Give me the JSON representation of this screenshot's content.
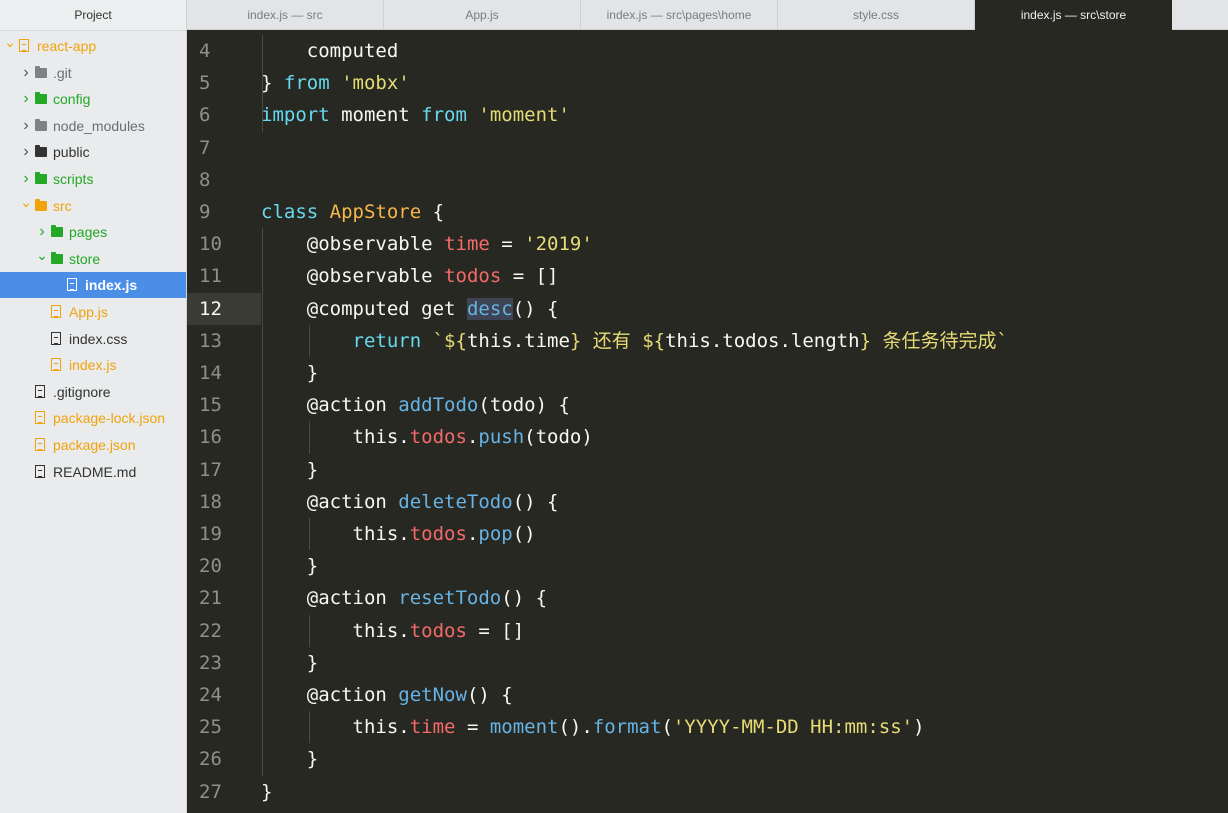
{
  "sidebar": {
    "title": "Project",
    "items": [
      {
        "label": "react-app",
        "icon": "project-icon",
        "arrow": "v",
        "depth": 0,
        "color": "#f0a30a",
        "type": "project"
      },
      {
        "label": ".git",
        "icon": "folder-icon",
        "arrow": ">",
        "depth": 1,
        "color": "#7f8285",
        "type": "folder"
      },
      {
        "label": "config",
        "icon": "folder-icon",
        "arrow": ">",
        "depth": 1,
        "color": "#23a827",
        "type": "folder"
      },
      {
        "label": "node_modules",
        "icon": "folder-icon",
        "arrow": ">",
        "depth": 1,
        "color": "#7f8285",
        "type": "folder"
      },
      {
        "label": "public",
        "icon": "folder-icon",
        "arrow": ">",
        "depth": 1,
        "color": "#333333",
        "type": "folder"
      },
      {
        "label": "scripts",
        "icon": "folder-icon",
        "arrow": ">",
        "depth": 1,
        "color": "#23a827",
        "type": "folder"
      },
      {
        "label": "src",
        "icon": "folder-icon",
        "arrow": "v",
        "depth": 1,
        "color": "#f0a30a",
        "type": "folder"
      },
      {
        "label": "pages",
        "icon": "folder-icon",
        "arrow": ">",
        "depth": 2,
        "color": "#23a827",
        "type": "folder"
      },
      {
        "label": "store",
        "icon": "folder-icon",
        "arrow": "v",
        "depth": 2,
        "color": "#23a827",
        "type": "folder"
      },
      {
        "label": "index.js",
        "icon": "file-icon",
        "arrow": "",
        "depth": 3,
        "color": "#ffffff",
        "type": "file",
        "selected": true
      },
      {
        "label": "App.js",
        "icon": "file-icon",
        "arrow": "",
        "depth": 2,
        "color": "#f0a30a",
        "type": "file"
      },
      {
        "label": "index.css",
        "icon": "file-icon",
        "arrow": "",
        "depth": 2,
        "color": "#333333",
        "type": "file"
      },
      {
        "label": "index.js",
        "icon": "file-icon",
        "arrow": "",
        "depth": 2,
        "color": "#f0a30a",
        "type": "file"
      },
      {
        "label": ".gitignore",
        "icon": "file-icon",
        "arrow": "",
        "depth": 1,
        "color": "#333333",
        "type": "file"
      },
      {
        "label": "package-lock.json",
        "icon": "file-icon",
        "arrow": "",
        "depth": 1,
        "color": "#f0a30a",
        "type": "file"
      },
      {
        "label": "package.json",
        "icon": "file-icon",
        "arrow": "",
        "depth": 1,
        "color": "#f0a30a",
        "type": "file"
      },
      {
        "label": "README.md",
        "icon": "readme-icon",
        "arrow": "",
        "depth": 1,
        "color": "#333333",
        "type": "file"
      }
    ]
  },
  "tabs": [
    {
      "label": "index.js — src",
      "active": false
    },
    {
      "label": "App.js",
      "active": false
    },
    {
      "label": "index.js — src\\pages\\home",
      "active": false
    },
    {
      "label": "style.css",
      "active": false
    },
    {
      "label": "index.js — src\\store",
      "active": true
    }
  ],
  "editor": {
    "active_line": 12,
    "lines": [
      {
        "n": "4",
        "code": "    computed"
      },
      {
        "n": "5",
        "code": "} from 'mobx'"
      },
      {
        "n": "6",
        "code": "import moment from 'moment'"
      },
      {
        "n": "7",
        "code": ""
      },
      {
        "n": "8",
        "code": ""
      },
      {
        "n": "9",
        "code": "class AppStore {"
      },
      {
        "n": "10",
        "code": "    @observable time = '2019'"
      },
      {
        "n": "11",
        "code": "    @observable todos = []"
      },
      {
        "n": "12",
        "code": "    @computed get desc() {"
      },
      {
        "n": "13",
        "code": "        return `${this.time} 还有 ${this.todos.length} 条任务待完成`"
      },
      {
        "n": "14",
        "code": "    }"
      },
      {
        "n": "15",
        "code": "    @action addTodo(todo) {"
      },
      {
        "n": "16",
        "code": "        this.todos.push(todo)"
      },
      {
        "n": "17",
        "code": "    }"
      },
      {
        "n": "18",
        "code": "    @action deleteTodo() {"
      },
      {
        "n": "19",
        "code": "        this.todos.pop()"
      },
      {
        "n": "20",
        "code": "    }"
      },
      {
        "n": "21",
        "code": "    @action resetTodo() {"
      },
      {
        "n": "22",
        "code": "        this.todos = []"
      },
      {
        "n": "23",
        "code": "    }"
      },
      {
        "n": "24",
        "code": "    @action getNow() {"
      },
      {
        "n": "25",
        "code": "        this.time = moment().format('YYYY-MM-DD HH:mm:ss')"
      },
      {
        "n": "26",
        "code": "    }"
      },
      {
        "n": "27",
        "code": "}"
      }
    ]
  }
}
